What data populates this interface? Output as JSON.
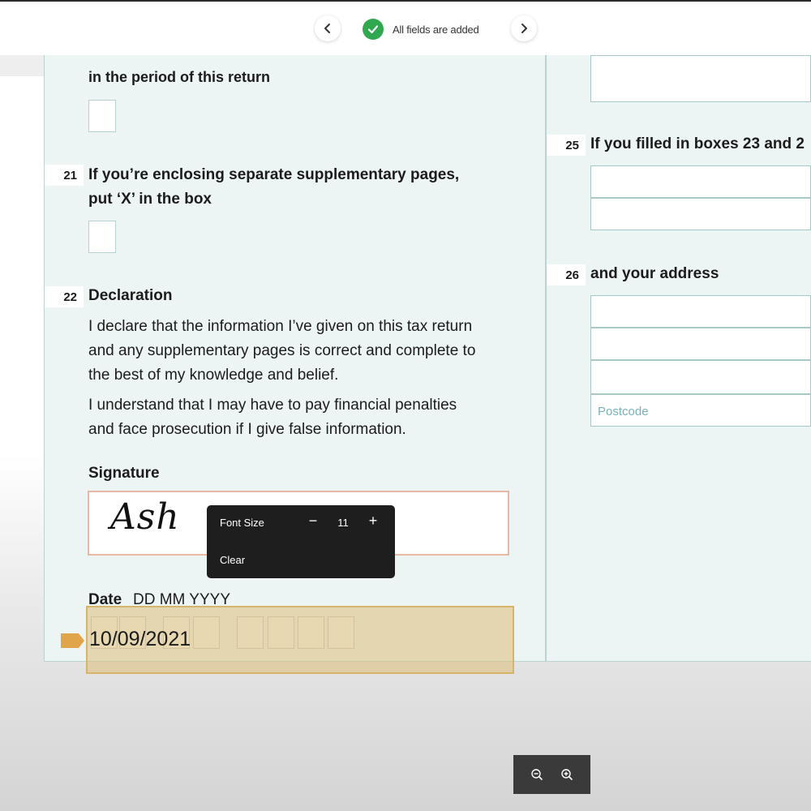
{
  "toolbar": {
    "status_text": "All fields are added",
    "prev_icon": "chevron-left-icon",
    "next_icon": "chevron-right-icon",
    "status_color": "#2fa84f"
  },
  "form": {
    "q20_partial": "in the period of this return",
    "q21": {
      "number": "21",
      "line1": "If you’re enclosing separate supplementary pages,",
      "line2": "put ‘X’ in the box"
    },
    "q22": {
      "number": "22",
      "title": "Declaration",
      "para1": [
        "I declare that the information I’ve given on this tax return",
        "and any supplementary pages is correct and complete to",
        "the best of my knowledge and belief."
      ],
      "para2": [
        "I understand that I may have to pay financial penalties",
        "and face prosecution if I give false information."
      ],
      "signature_label": "Signature",
      "signature_value": "Ash",
      "date_label": "Date",
      "date_format": "DD MM YYYY",
      "date_value": "10/09/2021"
    },
    "q25": {
      "number": "25",
      "text": "If you filled in boxes 23 and 2"
    },
    "q26": {
      "number": "26",
      "text": "and your address",
      "postcode_placeholder": "Postcode"
    }
  },
  "font_popup": {
    "label": "Font Size",
    "minus": "−",
    "value": "11",
    "plus": "+",
    "clear": "Clear"
  },
  "zoom": {
    "zoom_out_icon": "zoom-out-icon",
    "zoom_in_icon": "zoom-in-icon"
  },
  "colors": {
    "doc_background": "#ecf4f4",
    "field_highlight": "#debe78",
    "signature_border": "#e8b9a4"
  }
}
